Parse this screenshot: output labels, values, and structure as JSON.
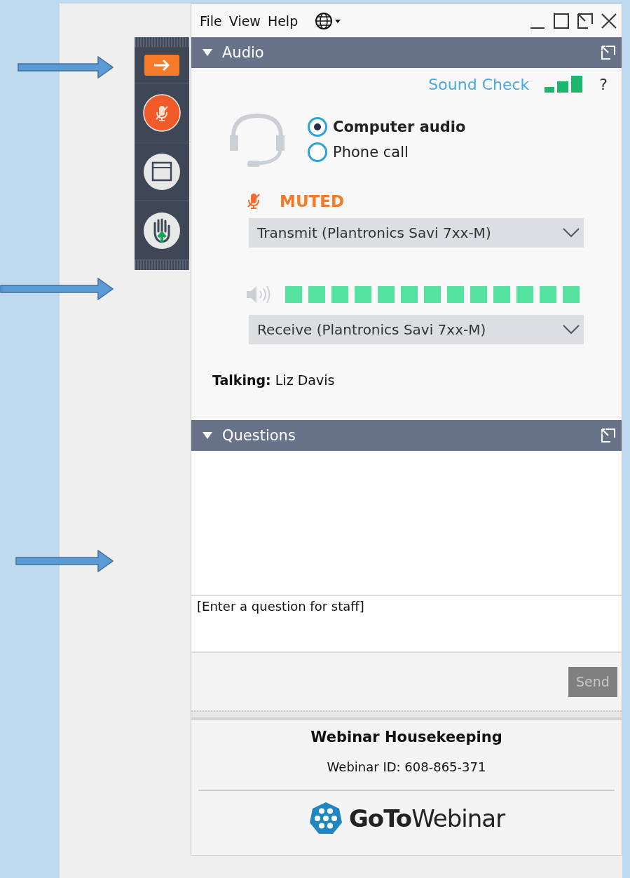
{
  "menu": [
    "File",
    "View",
    "Help"
  ],
  "audio": {
    "title": "Audio",
    "sound_check": "Sound Check",
    "help": "?",
    "options": [
      {
        "label": "Computer audio",
        "selected": true
      },
      {
        "label": "Phone call",
        "selected": false
      }
    ],
    "muted": true,
    "muted_label": "MUTED",
    "transmit": "Transmit (Plantronics Savi 7xx-M)",
    "receive": "Receive (Plantronics Savi 7xx-M)",
    "talking_label": "Talking:",
    "talking_name": "Liz Davis"
  },
  "questions": {
    "title": "Questions",
    "placeholder": "[Enter a question for staff]",
    "send": "Send",
    "send_disabled": true
  },
  "footer": {
    "title": "Webinar Housekeeping",
    "webinar_id": "Webinar ID: 608-865-371",
    "logo": "**GoTo**Webinar"
  }
}
